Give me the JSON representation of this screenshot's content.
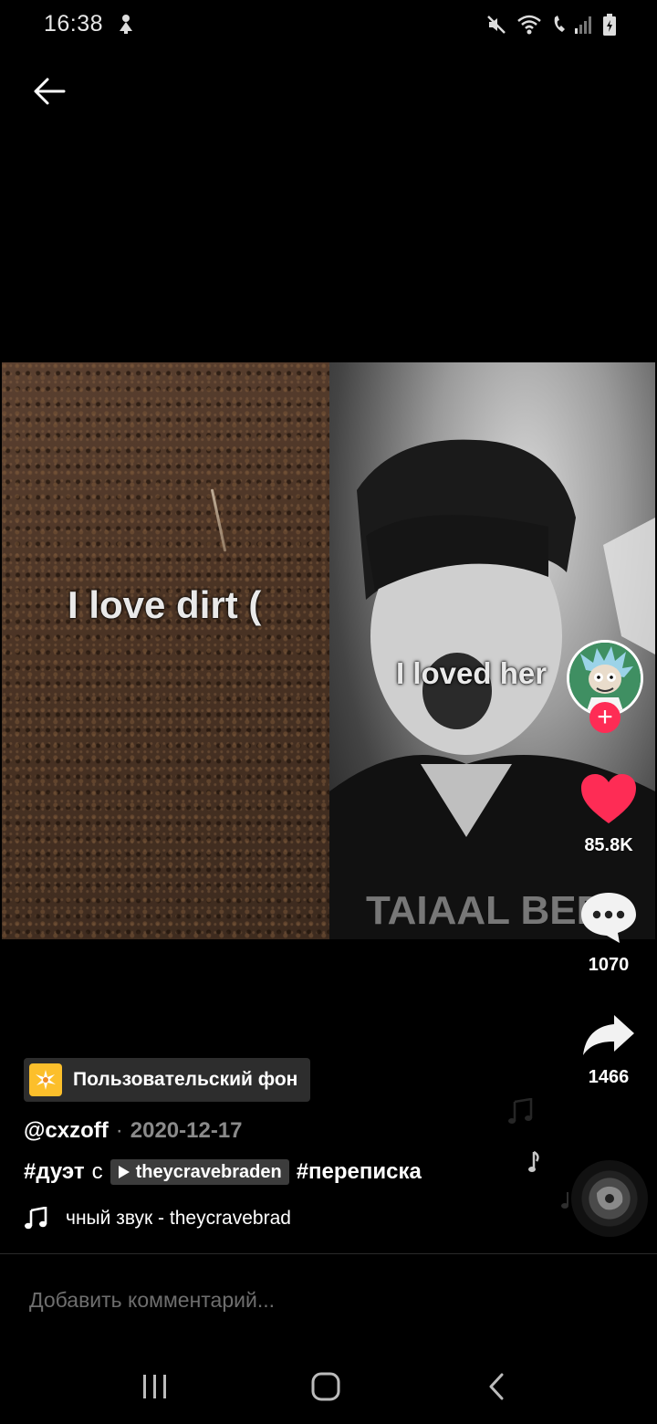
{
  "status_bar": {
    "time": "16:38"
  },
  "video": {
    "left_overlay_text": "I love dirt (",
    "right_overlay_text": "I loved her"
  },
  "actions": {
    "likes": "85.8K",
    "comments": "1070",
    "shares": "1466"
  },
  "effect": {
    "label": "Пользовательский фон"
  },
  "post": {
    "author": "@cxzoff",
    "separator": "·",
    "date": "2020-12-17",
    "caption_hashtag_1": "#дуэт",
    "caption_word": "с",
    "mention": "theycravebraden",
    "caption_hashtag_2": "#переписка",
    "music": "чный звук - theycravebrad"
  },
  "comment_box": {
    "placeholder": "Добавить комментарий..."
  },
  "colors": {
    "like_red": "#fe2c55",
    "effect_yellow": "#fcbf2b",
    "background": "#000000"
  },
  "icons": {
    "back": "back-arrow-icon",
    "like": "heart-icon",
    "comment": "comment-bubble-icon",
    "share": "share-arrow-icon",
    "music": "music-note-icon"
  }
}
